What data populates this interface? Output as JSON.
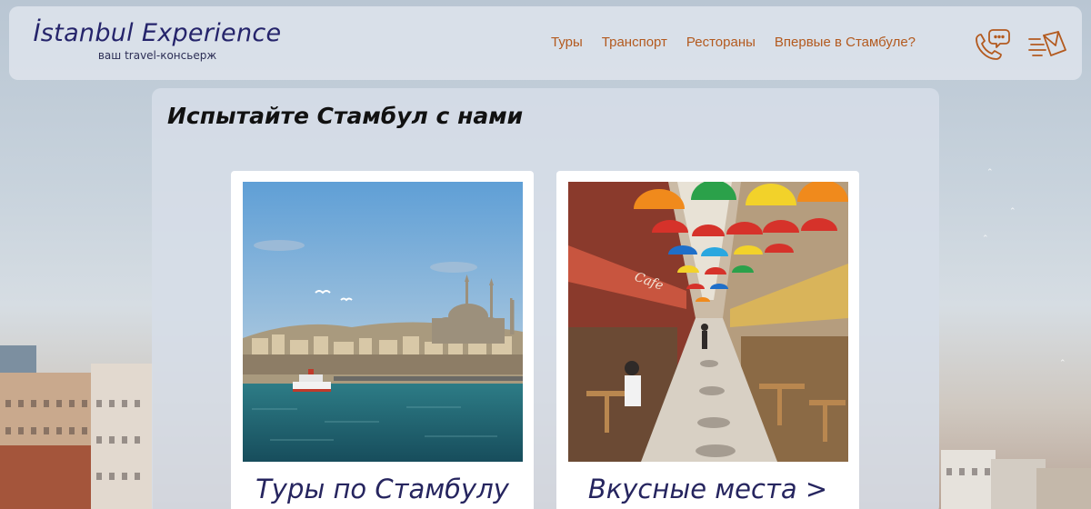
{
  "header": {
    "brand_title": "İstanbul Experience",
    "brand_subtitle": "ваш travel-консьерж",
    "nav": [
      {
        "label": "Туры"
      },
      {
        "label": "Транспорт"
      },
      {
        "label": "Рестораны"
      },
      {
        "label": "Впервые в Стамбуле?"
      }
    ],
    "icons": {
      "phone": "phone-chat-icon",
      "mail": "fast-mail-icon"
    }
  },
  "main": {
    "title": "Испытайте Стамбул с нами",
    "cards": [
      {
        "caption": "Туры по Стамбулу",
        "image": "istanbul-mosque-bosphorus-photo"
      },
      {
        "caption": "Вкусные места >",
        "image": "umbrella-street-cafe-photo"
      }
    ]
  },
  "colors": {
    "brand": "#25246b",
    "nav_accent": "#b35a1f",
    "card_caption": "#26255f"
  }
}
